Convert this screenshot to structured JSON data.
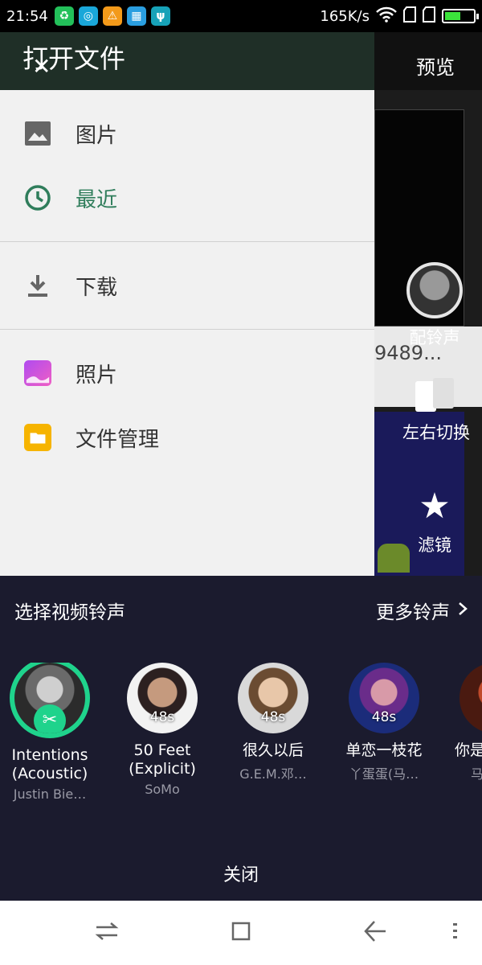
{
  "status_bar": {
    "time": "21:54",
    "network_speed": "165K/s",
    "notification_icons": [
      "wechat-like-icon",
      "app-icon",
      "warning-icon",
      "gallery-icon",
      "usb-icon"
    ]
  },
  "background_app": {
    "preview_label": "预览",
    "partial_number": "9489...",
    "tools": [
      {
        "label": "配铃声",
        "icon": "avatar-ringtone-icon"
      },
      {
        "label": "左右切换",
        "icon": "swap-icon"
      },
      {
        "label": "滤镜",
        "icon": "filter-icon"
      }
    ]
  },
  "drawer": {
    "title": "打开文件",
    "items": [
      {
        "label": "图片",
        "icon": "image-icon"
      },
      {
        "label": "最近",
        "icon": "clock-icon",
        "active": true
      },
      {
        "label": "下载",
        "icon": "download-icon"
      },
      {
        "label": "照片",
        "icon": "photos-app-icon"
      },
      {
        "label": "文件管理",
        "icon": "folder-icon"
      }
    ]
  },
  "ringtone_sheet": {
    "title": "选择视频铃声",
    "more_label": "更多铃声",
    "close_label": "关闭",
    "songs": [
      {
        "title": "Intentions (Acoustic)",
        "artist": "Justin Bie…",
        "selected": true
      },
      {
        "title": "50 Feet (Explicit)",
        "artist": "SoMo",
        "duration": "48s"
      },
      {
        "title": "很久以后",
        "artist": "G.E.M.邓…",
        "duration": "48s"
      },
      {
        "title": "单恋一枝花",
        "artist": "丫蛋蛋(马…",
        "duration": "48s"
      },
      {
        "title": "你是的",
        "artist": "马"
      }
    ]
  },
  "colors": {
    "accent_green": "#1fd38c",
    "drawer_active": "#2f7d5b",
    "sheet_bg": "#1b1b2e"
  }
}
